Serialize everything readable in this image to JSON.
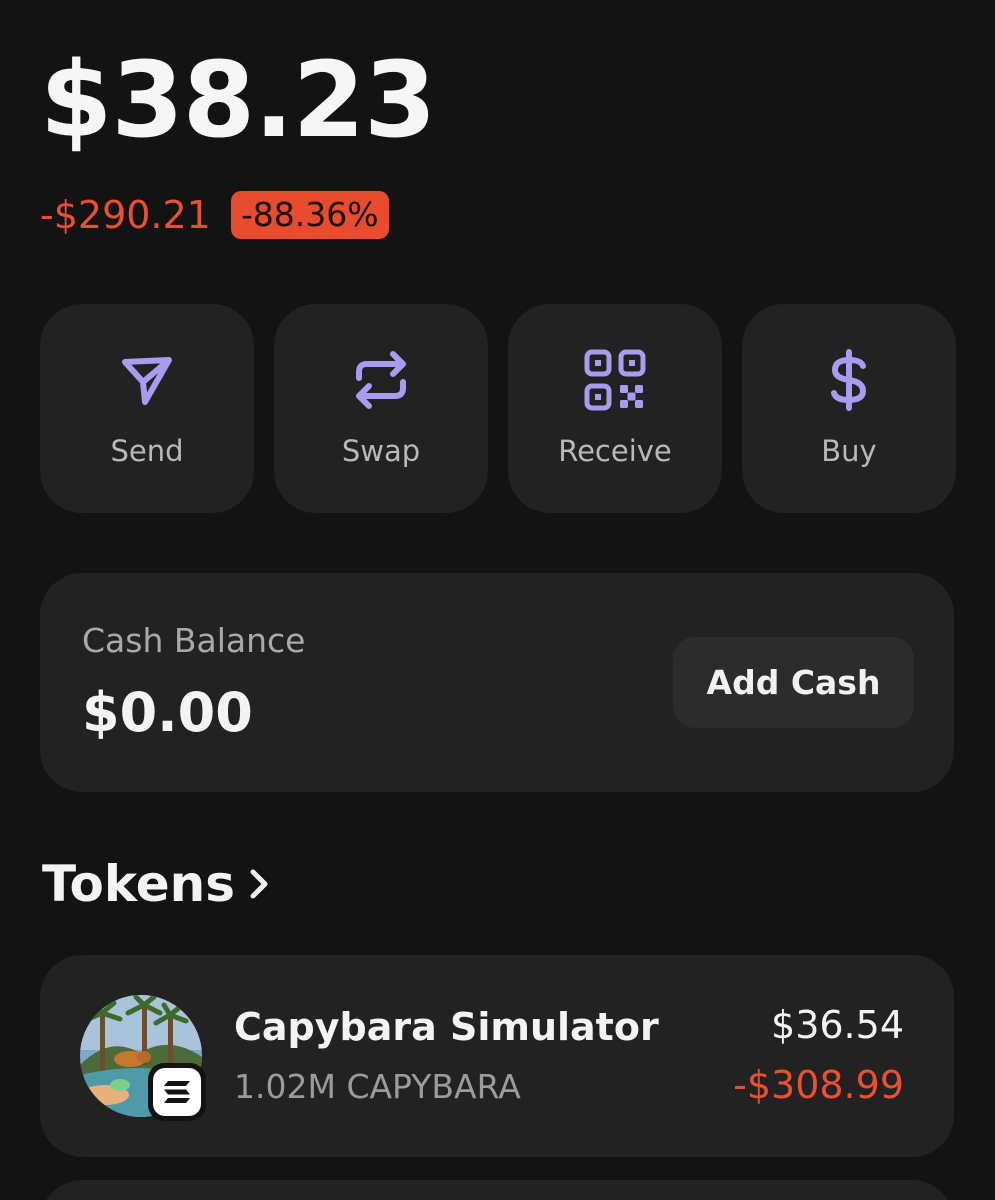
{
  "portfolio": {
    "balance": "$38.23",
    "change_amount": "-$290.21",
    "change_percent": "-88.36%"
  },
  "actions": [
    {
      "label": "Send",
      "icon": "send-icon"
    },
    {
      "label": "Swap",
      "icon": "swap-icon"
    },
    {
      "label": "Receive",
      "icon": "qr-code-icon"
    },
    {
      "label": "Buy",
      "icon": "dollar-icon"
    }
  ],
  "cash": {
    "title": "Cash Balance",
    "value": "$0.00",
    "button_label": "Add Cash"
  },
  "tokens": {
    "title": "Tokens",
    "items": [
      {
        "name": "Capybara Simulator",
        "amount": "1.02M CAPYBARA",
        "value": "$36.54",
        "change": "-$308.99"
      }
    ]
  },
  "colors": {
    "background": "#131313",
    "card": "#222222",
    "accent": "#a99bf0",
    "negative": "#eb4f2f"
  }
}
